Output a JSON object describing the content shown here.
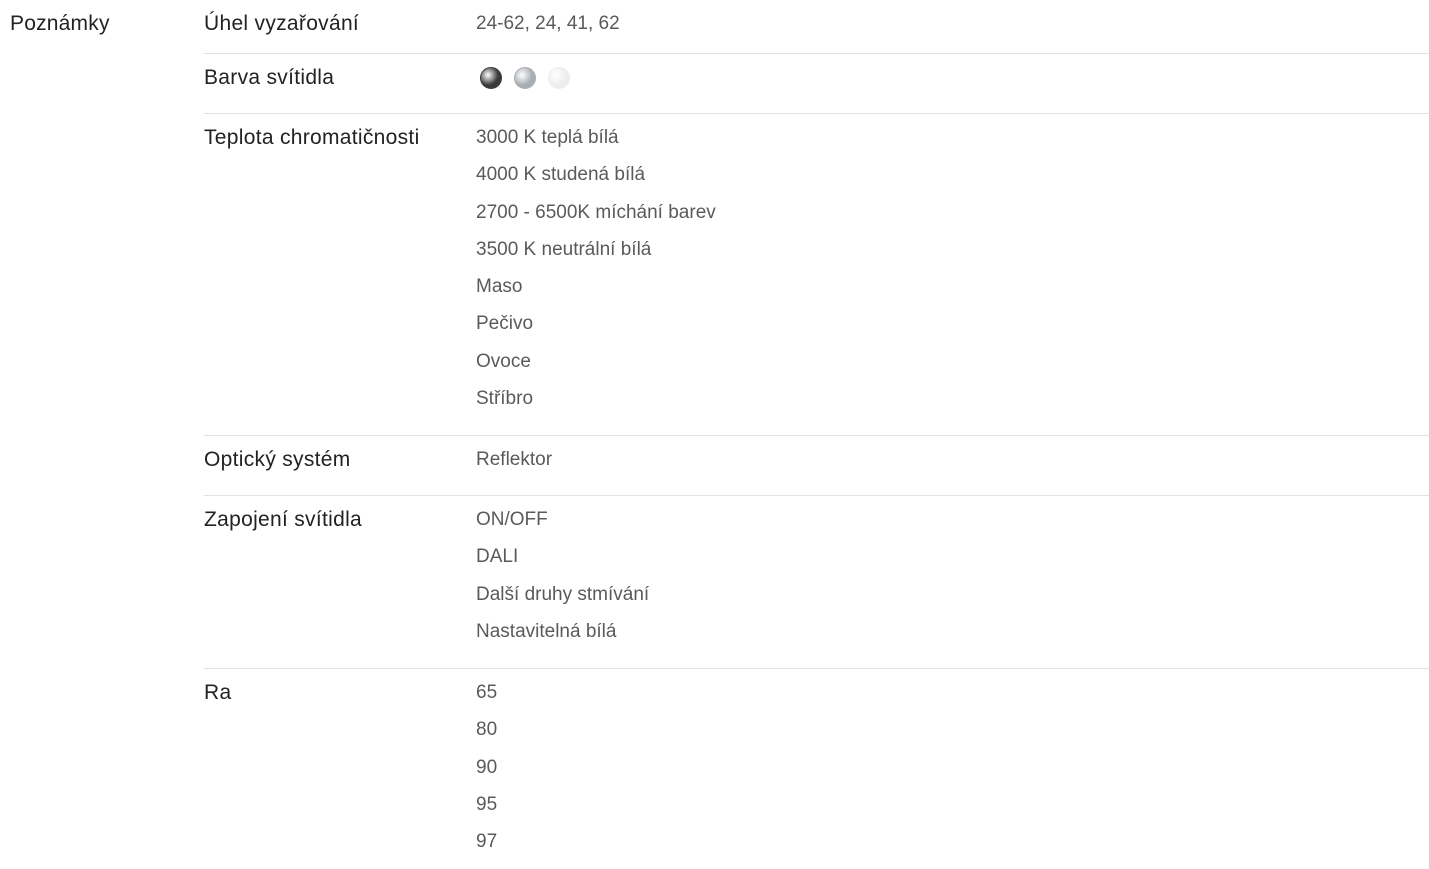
{
  "section": {
    "label": "Poznámky"
  },
  "specs": [
    {
      "key": "Úhel vyzařování",
      "values": [
        "24-62, 24, 41, 62"
      ]
    },
    {
      "key": "Barva svítidla",
      "swatches": [
        {
          "icon": "dark-grey-swatch",
          "color": "#3a3a3a"
        },
        {
          "icon": "silver-swatch",
          "color": "#a9aeb3"
        },
        {
          "icon": "white-swatch",
          "color": "#ededed"
        }
      ]
    },
    {
      "key": "Teplota chromatičnosti",
      "values": [
        "3000 K teplá bílá",
        "4000 K studená bílá",
        "2700 - 6500K míchání barev",
        "3500 K neutrální bílá",
        "Maso",
        "Pečivo",
        "Ovoce",
        "Stříbro"
      ]
    },
    {
      "key": "Optický systém",
      "values": [
        "Reflektor"
      ]
    },
    {
      "key": "Zapojení svítidla",
      "values": [
        "ON/OFF",
        "DALI",
        "Další druhy stmívání",
        "Nastavitelná bílá"
      ]
    },
    {
      "key": "Ra",
      "values": [
        "65",
        "80",
        "90",
        "95",
        "97"
      ]
    }
  ]
}
